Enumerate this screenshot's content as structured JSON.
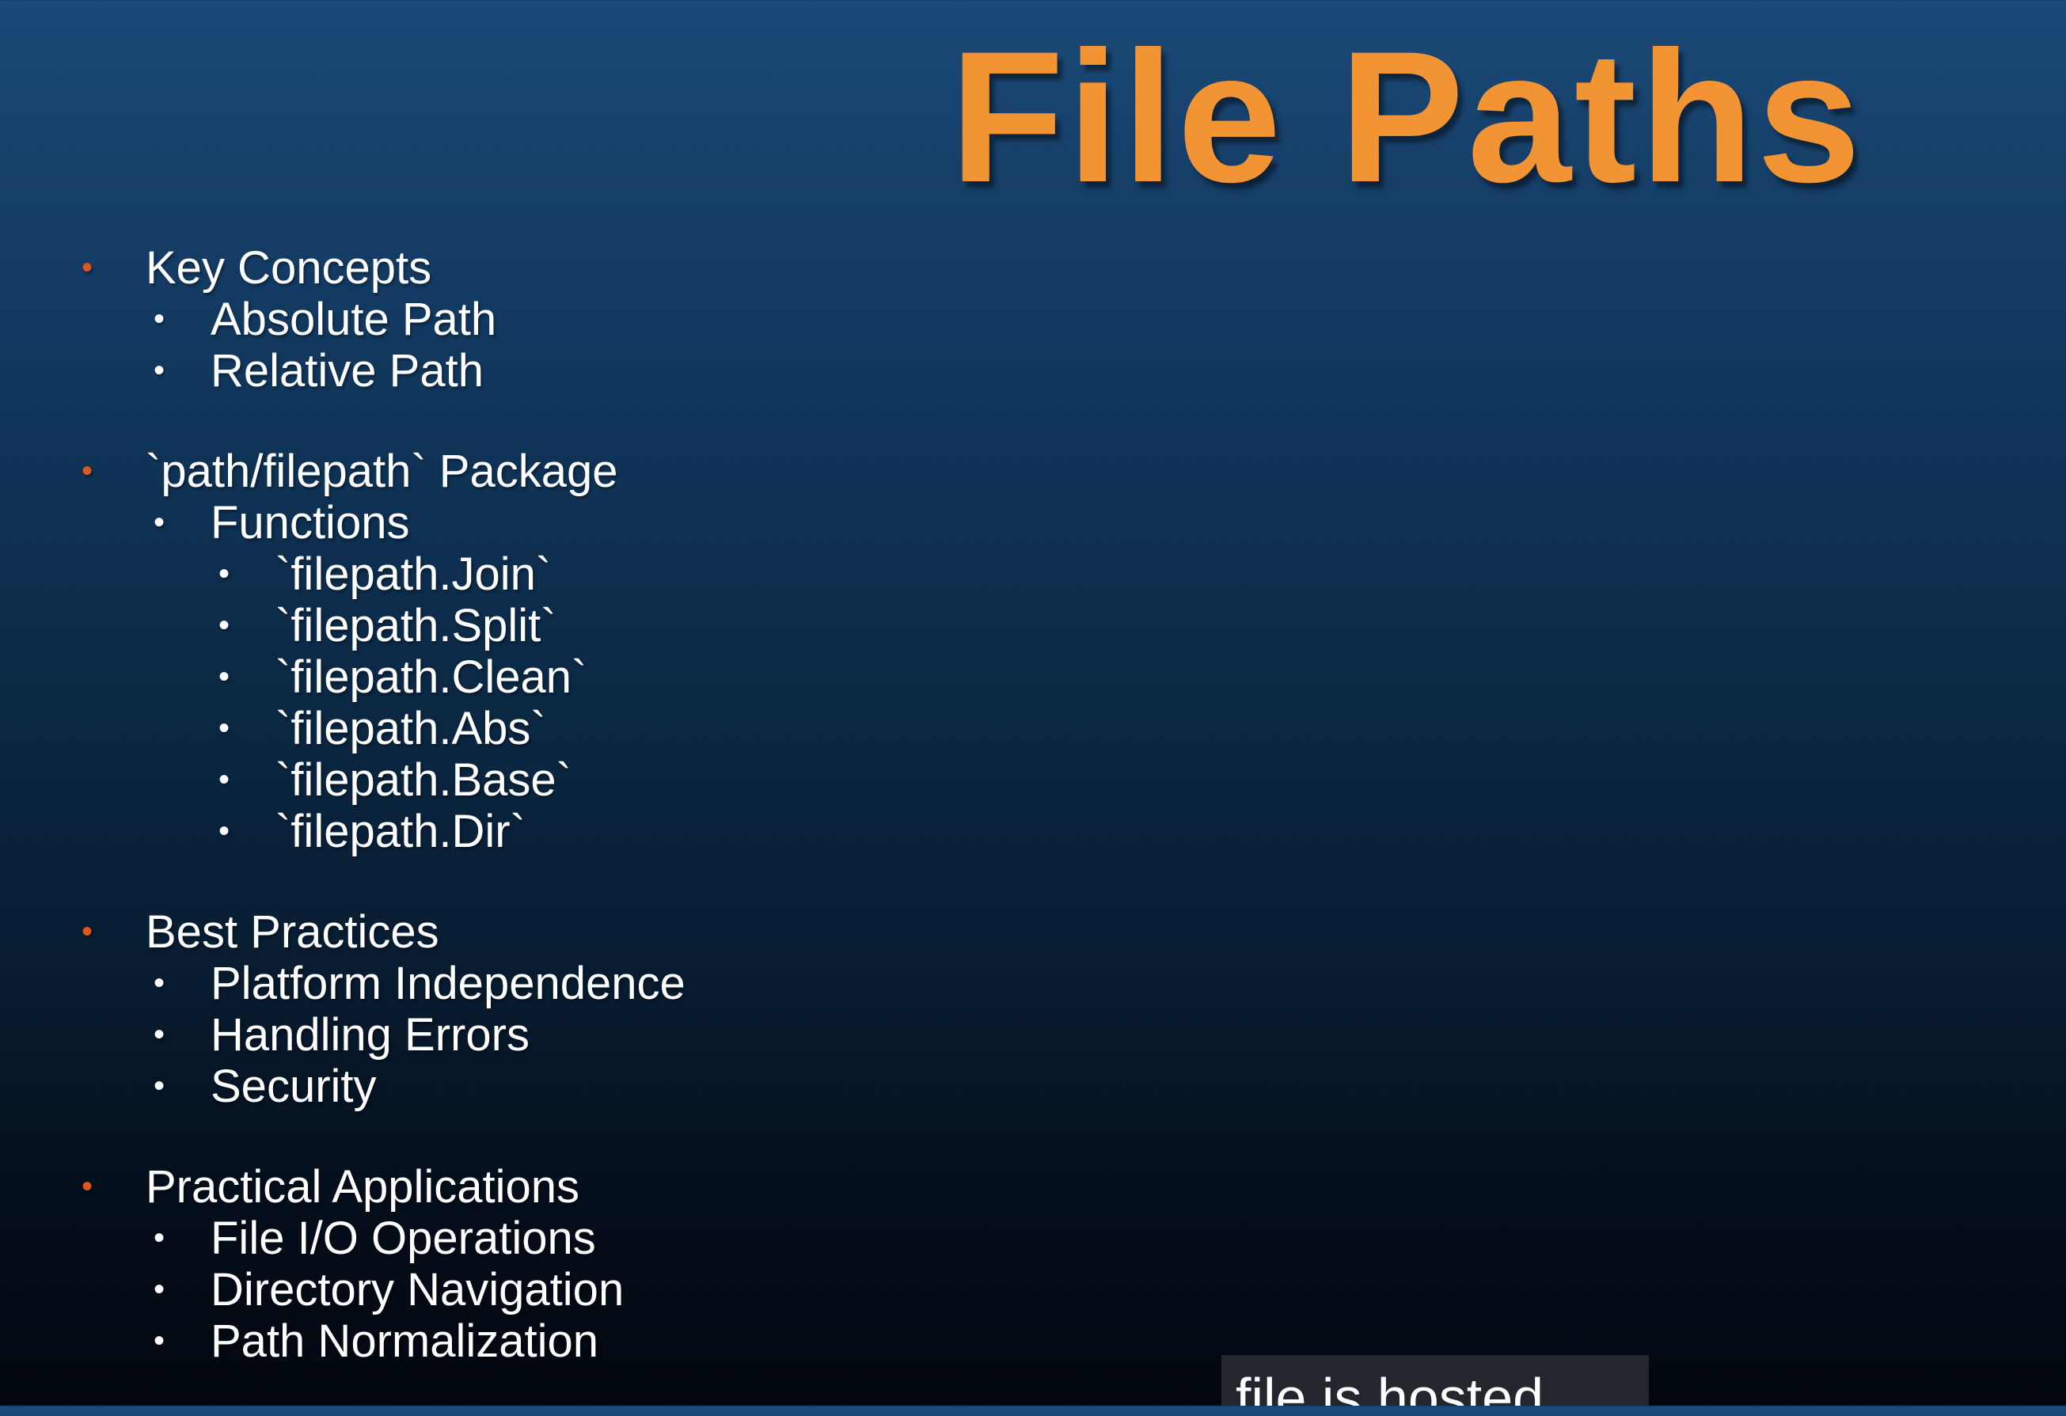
{
  "slide": {
    "title": "File Paths",
    "title_color": "#f39434",
    "bullet_accent_color": "#e0561c",
    "background_top": "#1b4a78",
    "background_bottom": "#02070e"
  },
  "outline": [
    {
      "heading": "Key Concepts",
      "items": [
        {
          "label": "Absolute Path",
          "children": []
        },
        {
          "label": "Relative Path",
          "children": []
        }
      ]
    },
    {
      "heading": "`path/filepath` Package",
      "items": [
        {
          "label": "Functions",
          "children": [
            "`filepath.Join`",
            "`filepath.Split`",
            "`filepath.Clean`",
            "`filepath.Abs`",
            "`filepath.Base`",
            "`filepath.Dir`"
          ]
        }
      ]
    },
    {
      "heading": "Best Practices",
      "items": [
        {
          "label": "Platform Independence",
          "children": []
        },
        {
          "label": "Handling Errors",
          "children": []
        },
        {
          "label": "Security",
          "children": []
        }
      ]
    },
    {
      "heading": "Practical Applications",
      "items": [
        {
          "label": "File I/O Operations",
          "children": []
        },
        {
          "label": "Directory Navigation",
          "children": []
        },
        {
          "label": "Path Normalization",
          "children": []
        }
      ]
    }
  ],
  "caption": {
    "text": "file is hosted"
  }
}
